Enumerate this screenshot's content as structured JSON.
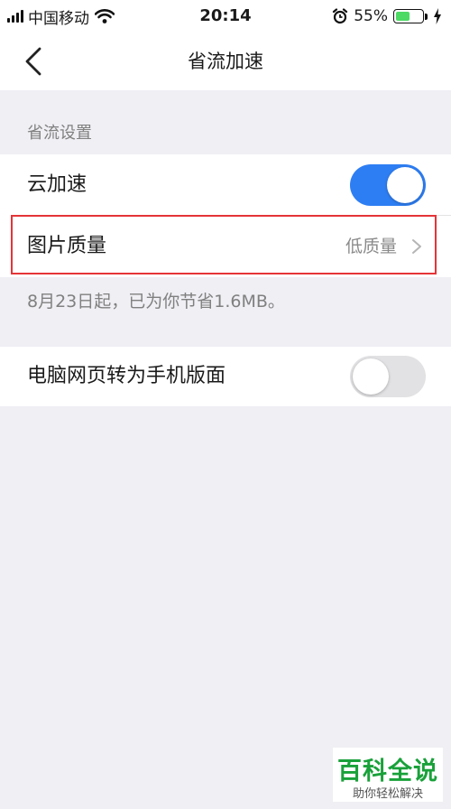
{
  "status_bar": {
    "carrier": "中国移动",
    "time": "20:14",
    "battery_percent": "55%",
    "battery_level": 0.55,
    "icons": [
      "signal-icon",
      "wifi-icon",
      "alarm-icon",
      "battery-icon",
      "charging-icon"
    ]
  },
  "nav": {
    "title": "省流加速",
    "back_icon": "chevron-left-icon"
  },
  "section": {
    "header": "省流设置"
  },
  "settings": {
    "cloud_accel": {
      "label": "云加速",
      "enabled": true
    },
    "image_quality": {
      "label": "图片质量",
      "value": "低质量",
      "icon": "chevron-right-icon"
    },
    "savings_note": "8月23日起，已为你节省1.6MB。",
    "desktop_to_mobile": {
      "label": "电脑网页转为手机版面",
      "enabled": false
    }
  },
  "colors": {
    "accent": "#2e7ef3",
    "highlight_border": "#e53437",
    "battery_fill": "#4cd964",
    "watermark": "#19a13a"
  },
  "watermark": {
    "title": "百科全说",
    "subtitle": "助你轻松解决"
  }
}
